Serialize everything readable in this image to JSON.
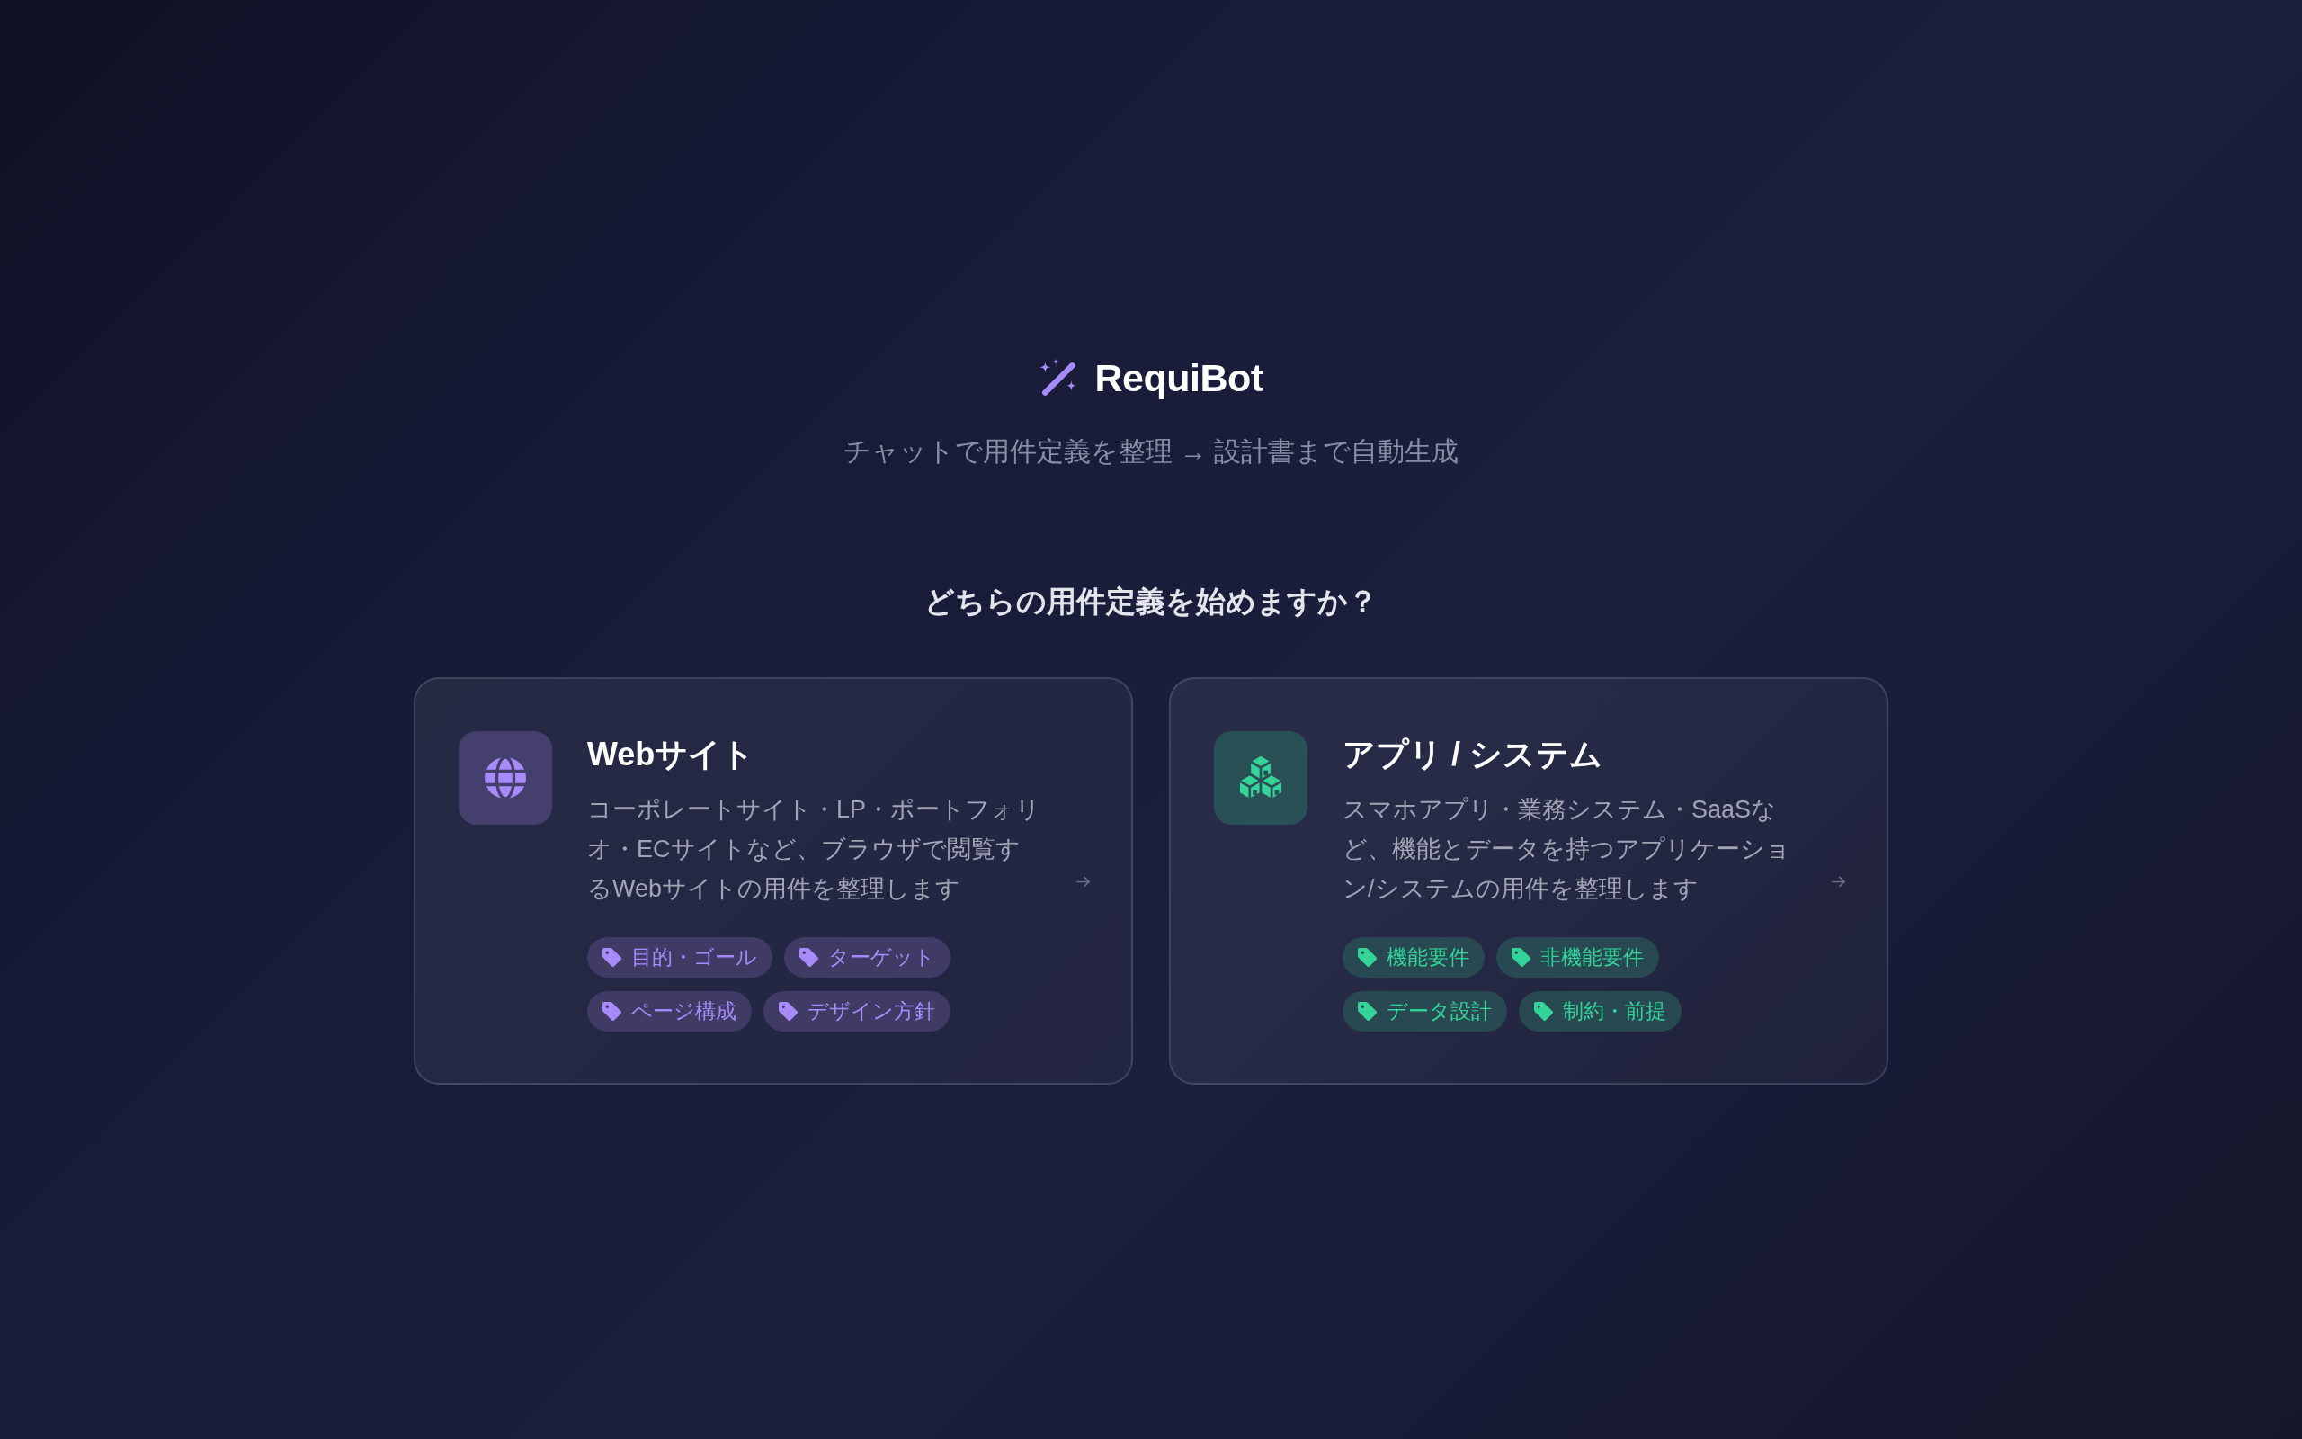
{
  "header": {
    "logo_text": "RequiBot",
    "subtitle": "チャットで用件定義を整理 → 設計書まで自動生成"
  },
  "prompt": "どちらの用件定義を始めますか？",
  "options": [
    {
      "kind": "website",
      "color": "#a78bfa",
      "title": "Webサイト",
      "description": "コーポレートサイト・LP・ポートフォリオ・ECサイトなど、ブラウザで閲覧するWebサイトの用件を整理します",
      "tags": [
        "目的・ゴール",
        "ターゲット",
        "ページ構成",
        "デザイン方針"
      ]
    },
    {
      "kind": "app",
      "color": "#34d399",
      "title": "アプリ / システム",
      "description": "スマホアプリ・業務システム・SaaSなど、機能とデータを持つアプリケーション/システムの用件を整理します",
      "tags": [
        "機能要件",
        "非機能要件",
        "データ設計",
        "制約・前提"
      ]
    }
  ]
}
